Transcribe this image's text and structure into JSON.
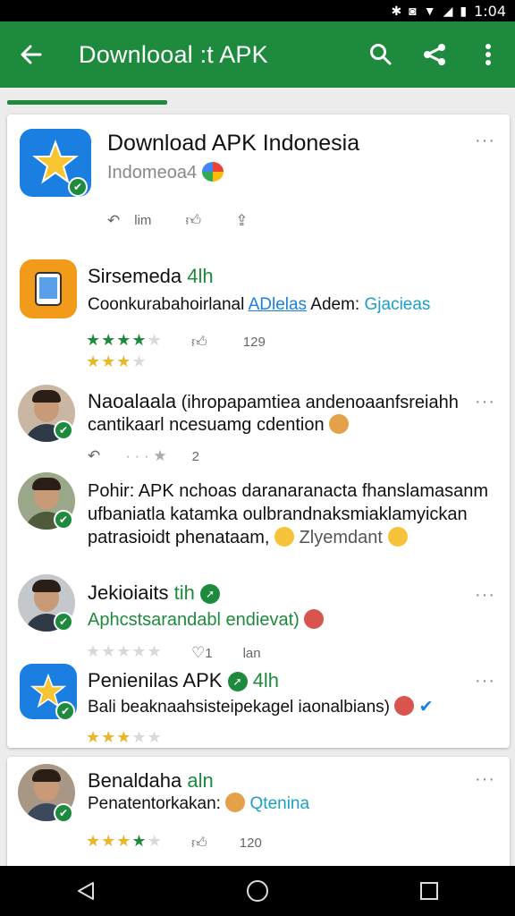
{
  "status_bar": {
    "time": "1:04"
  },
  "app_bar": {
    "title": "Downlooal :t APK"
  },
  "loading_progress": 0.32,
  "colors": {
    "primary": "#1e8a3d",
    "link": "#1a7fe0",
    "star_gold": "#e8b62a"
  },
  "featured": {
    "title": "Download APK Indonesia",
    "subtitle": "Indomeoa4",
    "action_count": "lim",
    "more": "···",
    "icon": "star-app-icon"
  },
  "posts": [
    {
      "name": "Sirsemeda",
      "time": "4lh",
      "text_line1_prefix": "Coonkurabahoirlanal",
      "text_link": "ADlelas",
      "text_mid": "Adem:",
      "text_tag": "Gjacieas",
      "rating_green": "★★★★",
      "rating_gold": "★★★",
      "action_count": "129"
    },
    {
      "name": "Naoalaala",
      "text_line1": "(ihropapamtiea andenoaanfsreiahh",
      "text_line2": "cantikaarl ncesuamg cdention",
      "action_count": "2",
      "more": "···"
    },
    {
      "name": "Pohir: APK",
      "text_line1_rest": "nchoas daranaranacta fhanslamasanm",
      "text_line2": "ufbaniatla katamka oulbrandnaksmiaklamyickan",
      "text_line3": "patrasioidt phenataam,",
      "text_line3_tail": "Zlyemdant"
    },
    {
      "name": "Jekioiaits",
      "time": "tih",
      "text_line1": "Aphcstsarandabl endievat)",
      "action_count1": "1",
      "action_count2": "lan",
      "more": "···"
    },
    {
      "name": "Penienilas APK",
      "time": "4lh",
      "text_line1": "Bali beaknaahsisteipekagel iaonalbians)",
      "more": "···"
    }
  ],
  "second_card": {
    "name": "Benaldaha",
    "time": "aln",
    "text_prefix": "Penatentorkakan:",
    "text_tag": "Qtenina",
    "action_count": "120",
    "more": "···"
  }
}
